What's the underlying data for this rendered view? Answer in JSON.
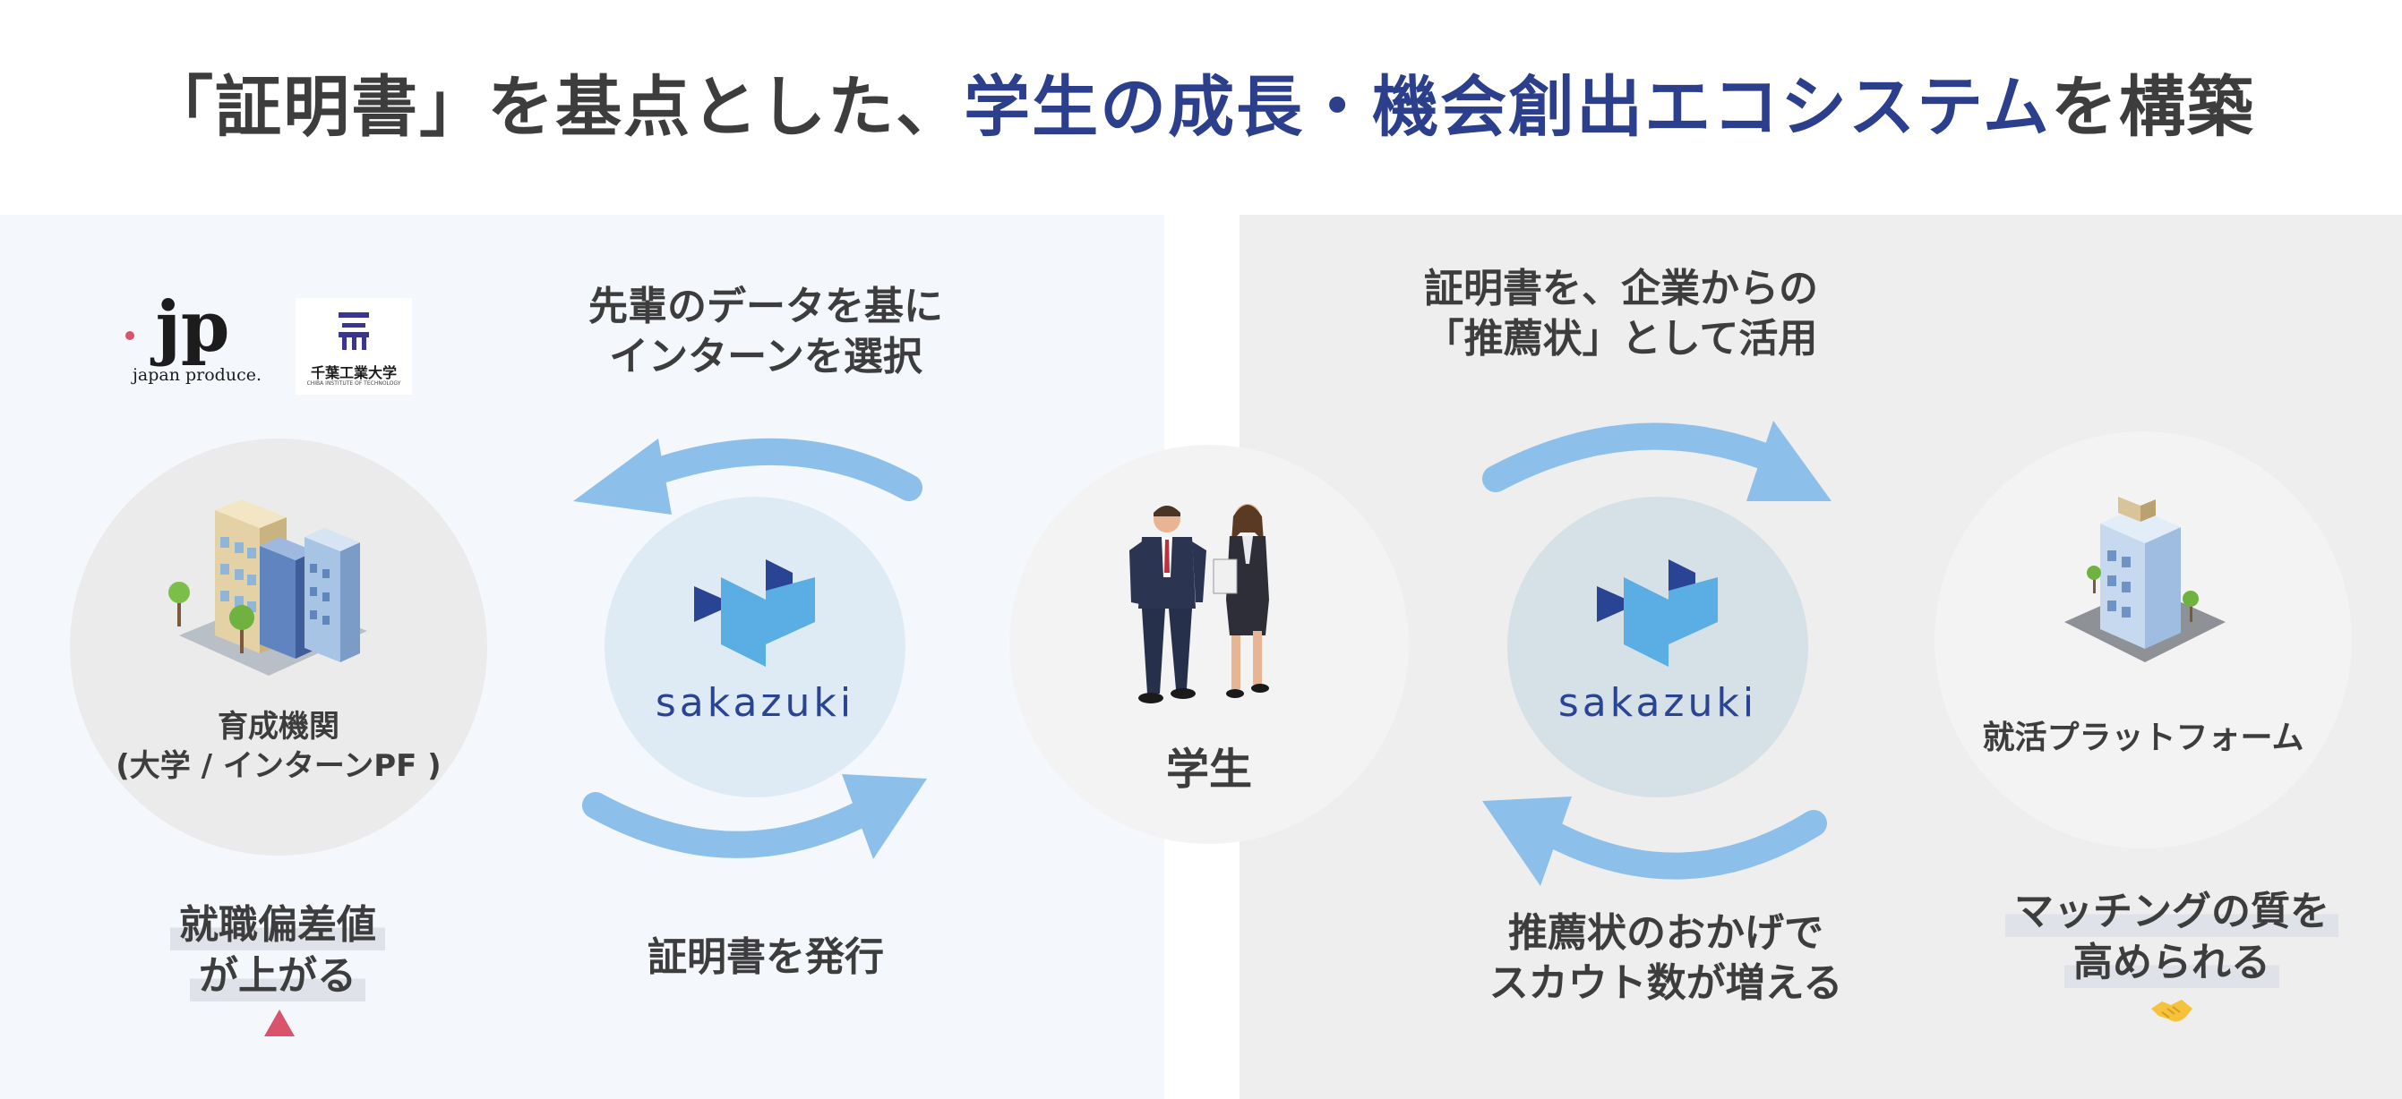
{
  "title": {
    "part1": "「証明書」を基点とした、",
    "part2": "学生の成長・機会創出エコシステム",
    "part3": "を構築"
  },
  "left_panel": {
    "jp_logo": {
      "mark": "jp",
      "text": "japan produce."
    },
    "university_logo": {
      "name": "千葉工業大学",
      "sub": "CHIBA INSTITUTE OF TECHNOLOGY"
    },
    "institution": {
      "line1": "育成機関",
      "line2": "(大学 / インターンPF )"
    },
    "top_arrow_text": {
      "line1": "先輩のデータを基に",
      "line2": "インターンを選択"
    },
    "bottom_arrow_text": "証明書を発行",
    "benefit": {
      "line1": "就職偏差値",
      "line2": "が上がる"
    },
    "benefit_icon": "up-triangle-icon"
  },
  "center": {
    "label": "学生"
  },
  "sakazuki": {
    "text": "sakazuki"
  },
  "right_panel": {
    "top_arrow_text": {
      "line1": "証明書を、企業からの",
      "line2": "「推薦状」として活用"
    },
    "bottom_arrow_text": {
      "line1": "推薦状のおかげで",
      "line2": "スカウト数が増える"
    },
    "platform": {
      "label": "就活プラットフォーム"
    },
    "benefit": {
      "line1": "マッチングの質を",
      "line2": "高められる"
    },
    "benefit_icon": "handshake-icon"
  },
  "colors": {
    "accent_navy": "#2b3f8c",
    "arrow_blue": "#8cc0ea",
    "triangle_red": "#d9536a",
    "logo_light_blue": "#5aaee3",
    "logo_navy": "#2a4494"
  }
}
